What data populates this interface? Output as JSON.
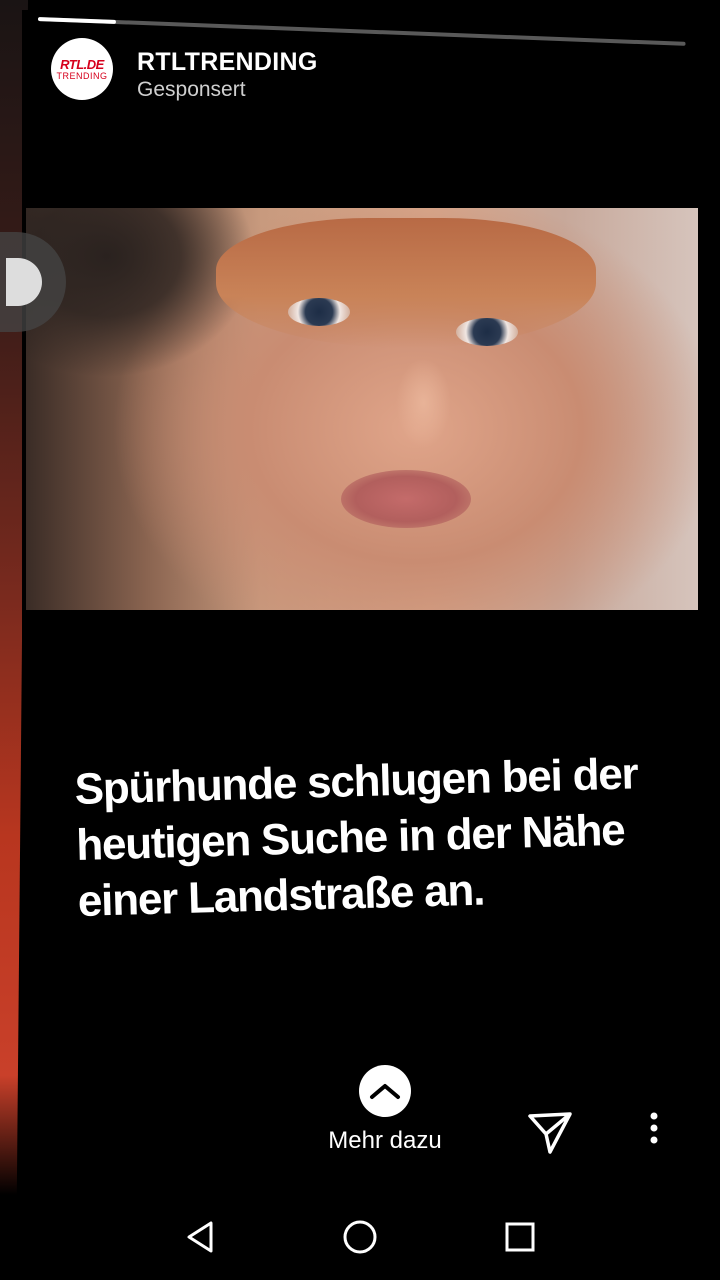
{
  "story": {
    "progress": 0.12,
    "account": {
      "logo_top": "RTL.DE",
      "logo_bottom": "TRENDING",
      "name": "RTLTRENDING",
      "sponsored_label": "Gesponsert"
    },
    "headline": "Spürhunde schlugen bei der heutigen Suche in der Nähe einer Landstraße an.",
    "cta": {
      "icon": "chevron-up-icon",
      "label": "Mehr dazu"
    },
    "actions": {
      "share_icon": "send-icon",
      "menu_icon": "more-vertical-icon"
    }
  },
  "navbar": {
    "back_icon": "back-triangle-icon",
    "home_icon": "home-circle-icon",
    "recents_icon": "recents-square-icon"
  }
}
